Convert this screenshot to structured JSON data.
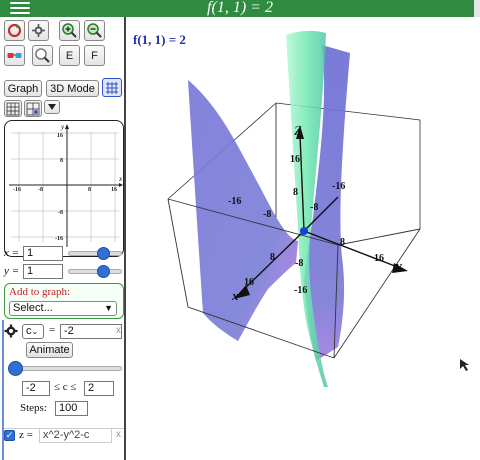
{
  "header": {
    "title": "f(1, 1) = 2"
  },
  "toolbar": {
    "e_label": "E",
    "f_label": "F",
    "graph_label": "Graph",
    "mode3d_label": "3D Mode"
  },
  "mini_graph": {
    "x_ticks": [
      "-16",
      "-8",
      "8",
      "16"
    ],
    "y_ticks": [
      "16",
      "8",
      "-8",
      "-16"
    ],
    "x_axis": "x",
    "y_axis": "y"
  },
  "controls": {
    "x_label": "x =",
    "x_value": "1",
    "y_label": "y =",
    "y_value": "1"
  },
  "add_to_graph": {
    "label": "Add to graph:",
    "select_value": "Select..."
  },
  "parameter": {
    "name": "c",
    "equals": "=",
    "value": "-2",
    "animate_label": "Animate",
    "min": "-2",
    "range_text": "≤ c ≤",
    "max": "2",
    "steps_label": "Steps:",
    "steps": "100"
  },
  "equation": {
    "lhs": "z =",
    "expression": "x^2-y^2-c",
    "visible": true
  },
  "plot": {
    "value_label": "f(1, 1) = 2",
    "axis_z": "Z",
    "axis_y": "y",
    "axis_x": "x",
    "ticks": {
      "z_16": "16",
      "z_8": "8",
      "z_m8": "-8",
      "z_m16": "-16",
      "x_m16": "-16",
      "x_m8": "-8",
      "x_8": "8",
      "x_16": "16",
      "y_m16": "-16",
      "y_m8": "-8",
      "y_8": "8",
      "y_16": "16"
    },
    "colors": {
      "surface_blue": "#7b79d6",
      "surface_green": "#7ff0b8",
      "surface_magenta": "#c77de6",
      "point": "#1a3fd8"
    }
  }
}
